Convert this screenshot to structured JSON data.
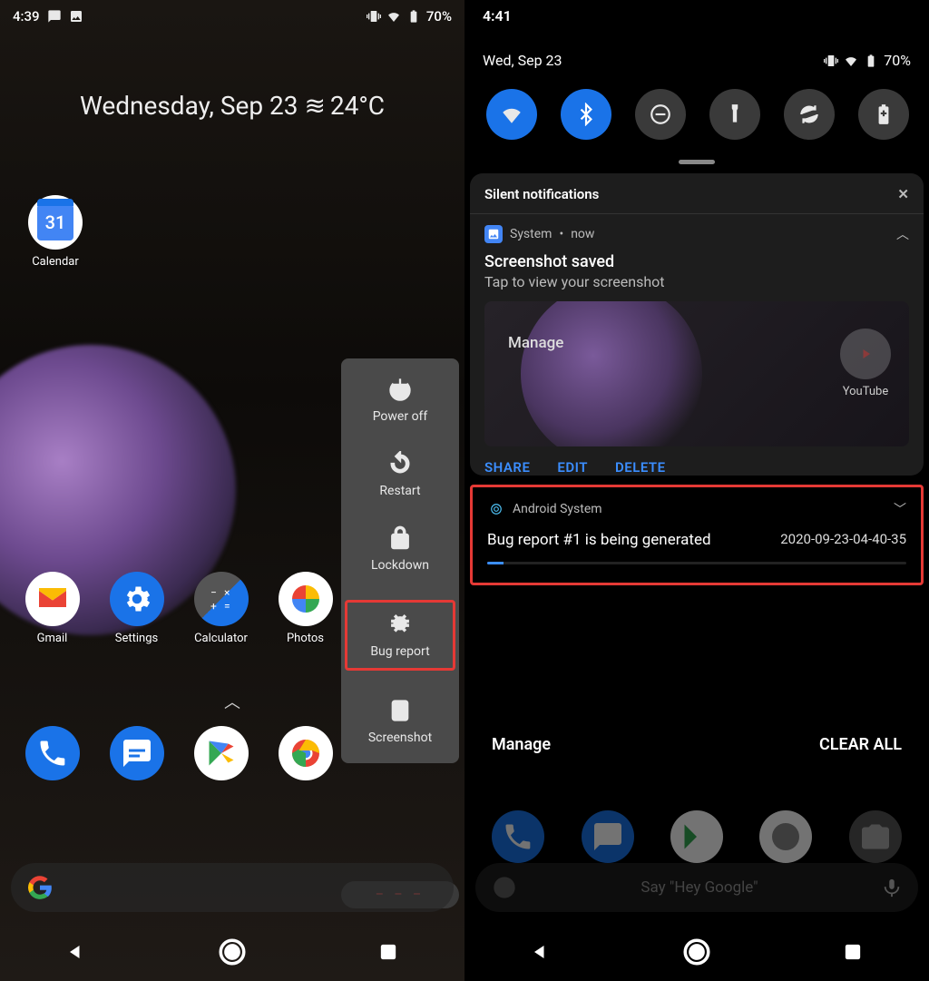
{
  "left": {
    "status": {
      "time": "4:39",
      "battery": "70%"
    },
    "dateWidget": {
      "date": "Wednesday, Sep 23",
      "weather_glyph": "≋",
      "temp": "24°C"
    },
    "calendar": {
      "day": "31",
      "label": "Calendar"
    },
    "row1": [
      {
        "name": "gmail",
        "label": "Gmail"
      },
      {
        "name": "settings",
        "label": "Settings"
      },
      {
        "name": "calculator",
        "label": "Calculator"
      },
      {
        "name": "photos",
        "label": "Photos"
      }
    ],
    "dock": [
      {
        "name": "phone"
      },
      {
        "name": "messages"
      },
      {
        "name": "play"
      },
      {
        "name": "chrome"
      }
    ],
    "powerMenu": [
      {
        "id": "power-off",
        "label": "Power off"
      },
      {
        "id": "restart",
        "label": "Restart"
      },
      {
        "id": "lockdown",
        "label": "Lockdown"
      },
      {
        "id": "bug-report",
        "label": "Bug report",
        "highlight": true
      },
      {
        "id": "screenshot",
        "label": "Screenshot"
      }
    ],
    "pillFooter": "– – –"
  },
  "right": {
    "status": {
      "time": "4:41",
      "battery": "70%"
    },
    "date": "Wed, Sep 23",
    "quickSettings": [
      {
        "id": "wifi",
        "on": true
      },
      {
        "id": "bluetooth",
        "on": true
      },
      {
        "id": "dnd",
        "on": false
      },
      {
        "id": "flashlight",
        "on": false
      },
      {
        "id": "rotate",
        "on": false
      },
      {
        "id": "battery-saver",
        "on": false
      }
    ],
    "silentHeader": "Silent notifications",
    "screenshotNotif": {
      "app": "System",
      "time": "now",
      "title": "Screenshot saved",
      "subtitle": "Tap to view your screenshot",
      "manage": "Manage",
      "youtube": "YouTube",
      "actions": [
        "SHARE",
        "EDIT",
        "DELETE"
      ]
    },
    "bugNotif": {
      "app": "Android System",
      "title": "Bug report #1 is being generated",
      "timestamp": "2020-09-23-04-40-35"
    },
    "bottom": {
      "manage": "Manage",
      "clearAll": "CLEAR ALL"
    },
    "searchHint": "Say \"Hey Google\""
  }
}
